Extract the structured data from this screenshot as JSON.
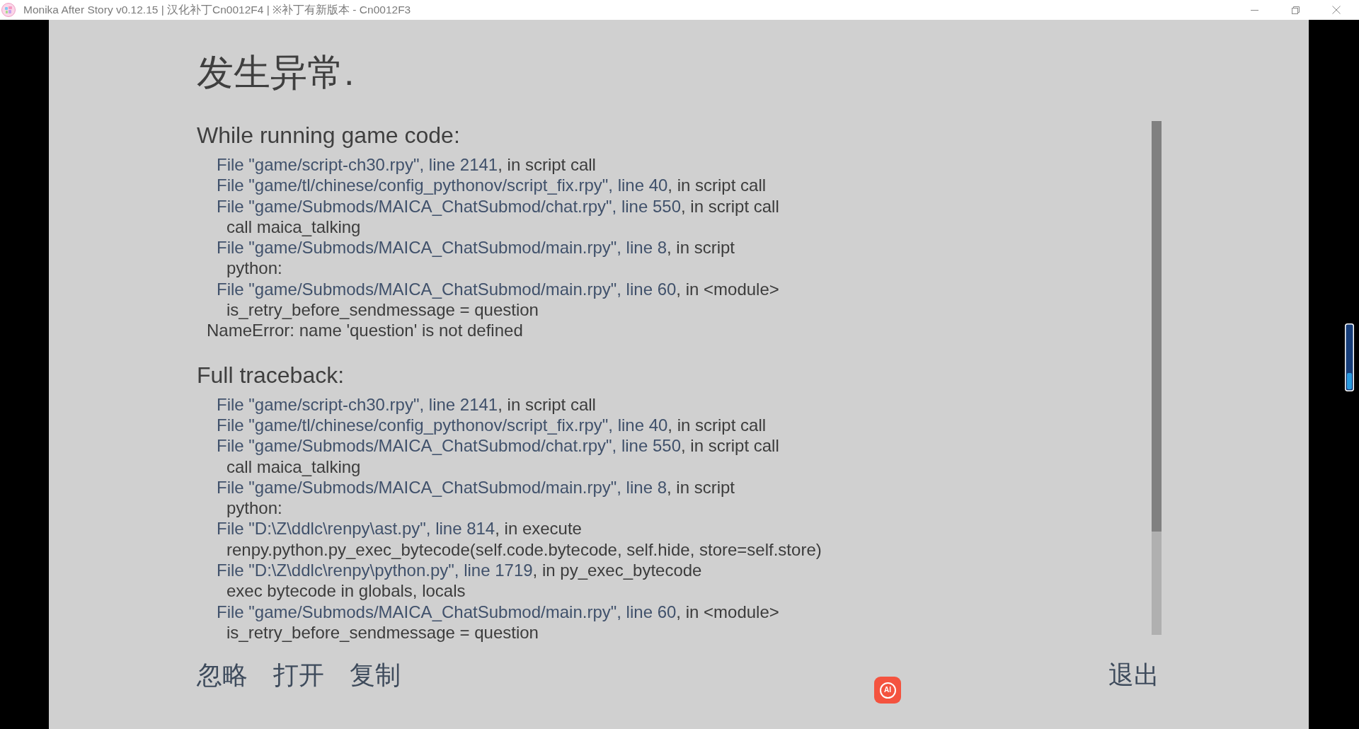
{
  "window": {
    "title": "Monika After Story v0.12.15 | 汉化补丁Cn0012F4 | ※补丁有新版本 - Cn0012F3"
  },
  "error_screen": {
    "title": "发生异常.",
    "sections": [
      {
        "heading": "While running game code:",
        "lines": [
          {
            "kind": "frame",
            "location": "File \"game/script-ch30.rpy\", line 2141",
            "context": ", in script call"
          },
          {
            "kind": "frame",
            "location": "File \"game/tl/chinese/config_pythonov/script_fix.rpy\", line 40",
            "context": ", in script call"
          },
          {
            "kind": "frame",
            "location": "File \"game/Submods/MAICA_ChatSubmod/chat.rpy\", line 550",
            "context": ", in script call"
          },
          {
            "kind": "source",
            "text": "call maica_talking"
          },
          {
            "kind": "frame",
            "location": "File \"game/Submods/MAICA_ChatSubmod/main.rpy\", line 8",
            "context": ", in script"
          },
          {
            "kind": "source",
            "text": "python:"
          },
          {
            "kind": "frame",
            "location": "File \"game/Submods/MAICA_ChatSubmod/main.rpy\", line 60",
            "context": ", in <module>"
          },
          {
            "kind": "source",
            "text": "is_retry_before_sendmessage = question"
          },
          {
            "kind": "error",
            "text": "NameError: name 'question' is not defined"
          }
        ]
      },
      {
        "heading": "Full traceback:",
        "lines": [
          {
            "kind": "frame",
            "location": "File \"game/script-ch30.rpy\", line 2141",
            "context": ", in script call"
          },
          {
            "kind": "frame",
            "location": "File \"game/tl/chinese/config_pythonov/script_fix.rpy\", line 40",
            "context": ", in script call"
          },
          {
            "kind": "frame",
            "location": "File \"game/Submods/MAICA_ChatSubmod/chat.rpy\", line 550",
            "context": ", in script call"
          },
          {
            "kind": "source",
            "text": "call maica_talking"
          },
          {
            "kind": "frame",
            "location": "File \"game/Submods/MAICA_ChatSubmod/main.rpy\", line 8",
            "context": ", in script"
          },
          {
            "kind": "source",
            "text": "python:"
          },
          {
            "kind": "frame",
            "location": "File \"D:\\Z\\ddlc\\renpy\\ast.py\", line 814",
            "context": ", in execute"
          },
          {
            "kind": "source",
            "text": "renpy.python.py_exec_bytecode(self.code.bytecode, self.hide, store=self.store)"
          },
          {
            "kind": "frame",
            "location": "File \"D:\\Z\\ddlc\\renpy\\python.py\", line 1719",
            "context": ", in py_exec_bytecode"
          },
          {
            "kind": "source",
            "text": "exec bytecode in globals, locals"
          },
          {
            "kind": "frame",
            "location": "File \"game/Submods/MAICA_ChatSubmod/main.rpy\", line 60",
            "context": ", in <module>"
          },
          {
            "kind": "source",
            "text": "is_retry_before_sendmessage = question"
          }
        ]
      }
    ],
    "actions": [
      "忽略",
      "打开",
      "复制"
    ],
    "exit_button": "退出"
  },
  "floating_assistant": {
    "label": "AI"
  }
}
